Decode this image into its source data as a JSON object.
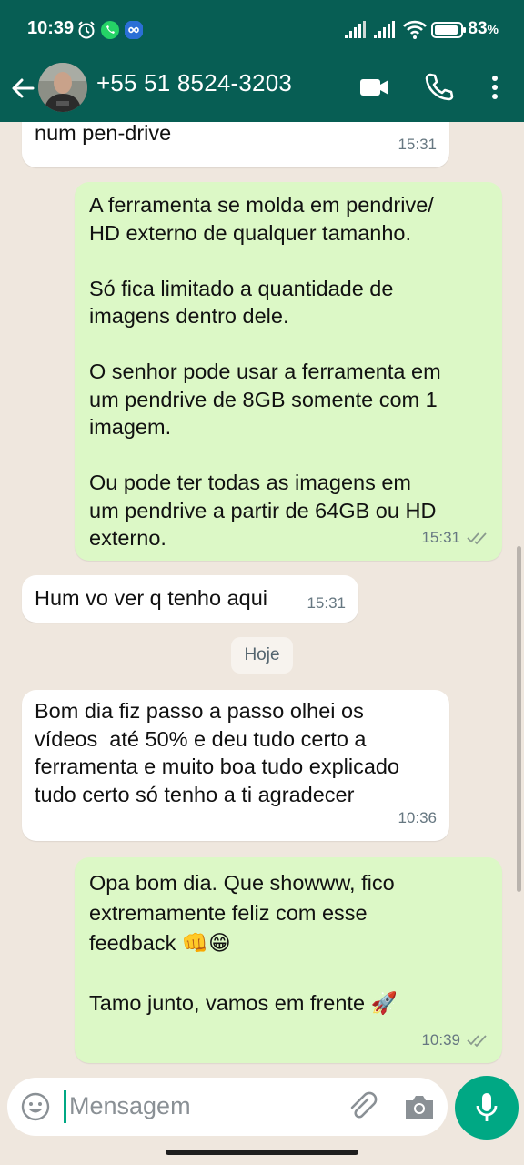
{
  "status_bar": {
    "time": "10:39",
    "battery": "83"
  },
  "header": {
    "contact": "+55 51 8524-3203"
  },
  "messages": [
    {
      "dir": "in",
      "text": "Quando eu estiver em casa vo por\nnum pen-drive",
      "time": "15:31"
    },
    {
      "dir": "out",
      "text": "A ferramenta se molda em pendrive/\nHD externo de qualquer tamanho.\n\nSó fica limitado a quantidade de\nimagens dentro dele.\n\nO senhor pode usar a ferramenta em\num pendrive de 8GB somente com 1\nimagem.\n\nOu pode ter todas as imagens em\num pendrive a partir de 64GB ou HD\nexterno.",
      "time": "15:31"
    },
    {
      "dir": "in",
      "text": "Hum vo ver q tenho aqui",
      "time": "15:31"
    },
    {
      "dir": "in",
      "text": "Bom dia fiz passo a passo olhei os\nvídeos  até 50% e deu tudo certo a\nferramenta e muito boa tudo explicado\ntudo certo só tenho a ti agradecer",
      "time": "10:36"
    },
    {
      "dir": "out",
      "text": "Opa bom dia. Que showww, fico\nextremamente feliz com esse\nfeedback 👊😁\n\nTamo junto, vamos em frente 🚀",
      "time": "10:39"
    }
  ],
  "day_divider": "Hoje",
  "input": {
    "placeholder": "Mensagem"
  },
  "colors": {
    "header": "#075e54",
    "outgoing": "#dcf8c6",
    "incoming": "#ffffff",
    "accent": "#00a884"
  },
  "icons": [
    "back-arrow-icon",
    "video-call-icon",
    "voice-call-icon",
    "more-options-icon",
    "emoji-icon",
    "attach-icon",
    "camera-icon",
    "mic-icon",
    "read-ticks-icon"
  ]
}
